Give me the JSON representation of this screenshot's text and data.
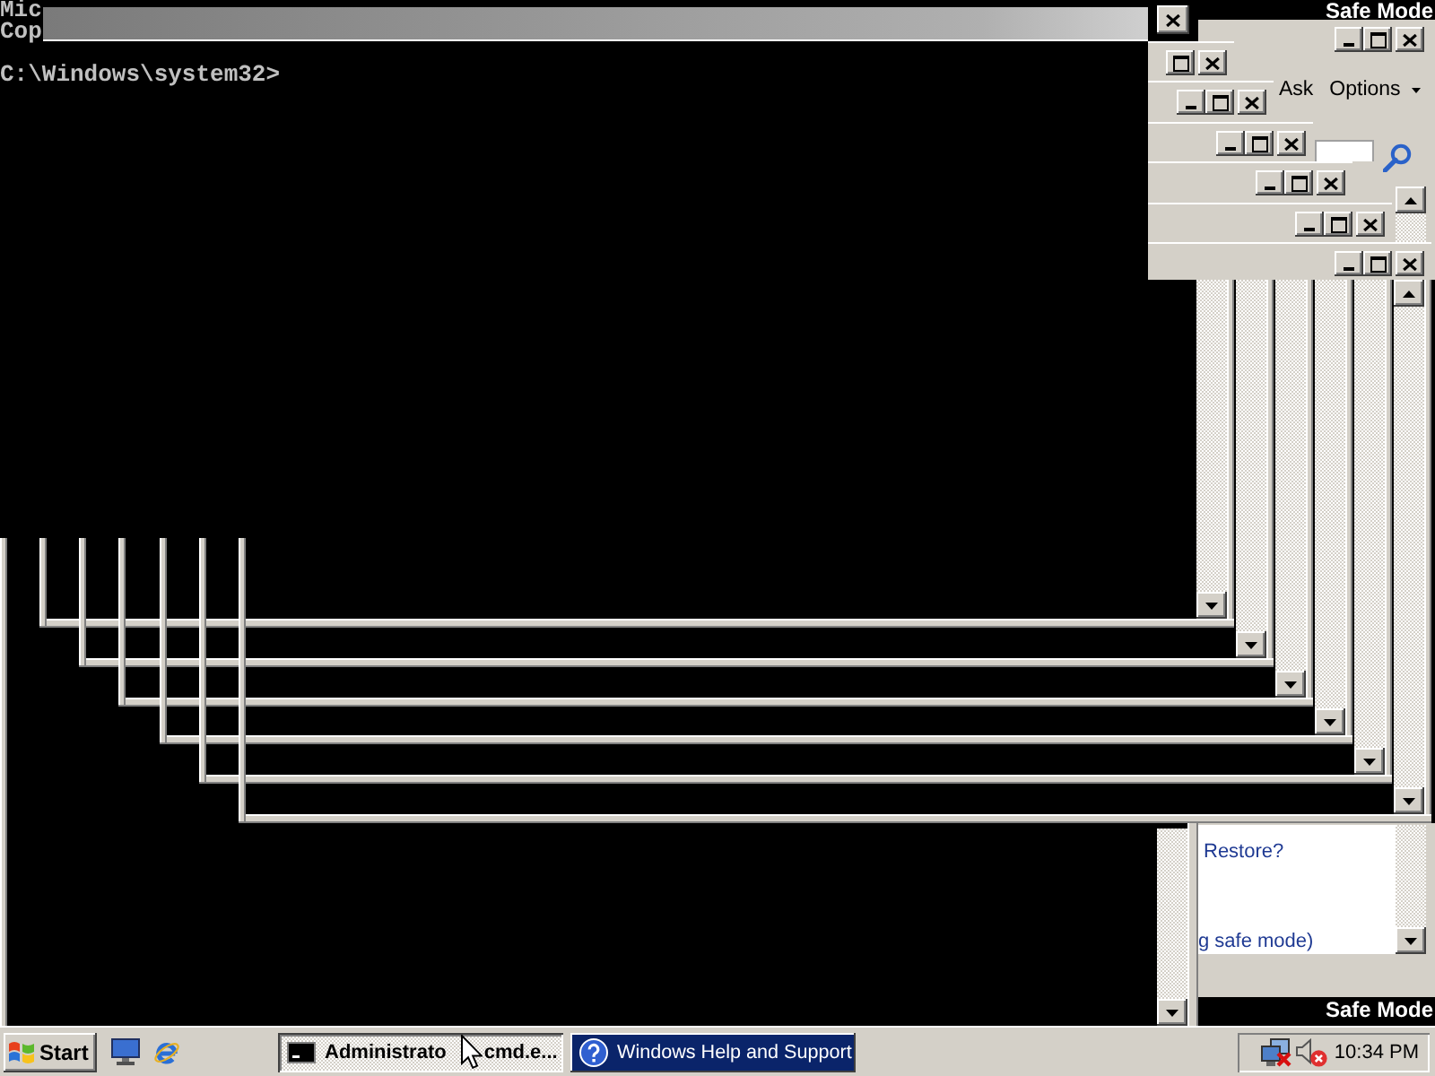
{
  "console": {
    "lines": [
      "Mic",
      "Cop"
    ],
    "prompt": "C:\\Windows\\system32>"
  },
  "help_window": {
    "toolbar": [
      {
        "label": "Ask",
        "kind": "button"
      },
      {
        "label": "Options",
        "kind": "menu"
      }
    ],
    "links": [
      "Restore?",
      "g safe mode)"
    ]
  },
  "corner_labels": {
    "top": "Safe Mode",
    "bottom": "Safe Mode"
  },
  "taskbar": {
    "start_label": "Start",
    "tasks": [
      {
        "label_parts": [
          "Administrato",
          "cmd.e..."
        ],
        "kind": "console",
        "selected": true,
        "flashing": false
      },
      {
        "label_parts": [
          "Windows Help and Support"
        ],
        "kind": "help",
        "selected": false,
        "flashing": true
      }
    ],
    "clock": "10:34 PM"
  }
}
